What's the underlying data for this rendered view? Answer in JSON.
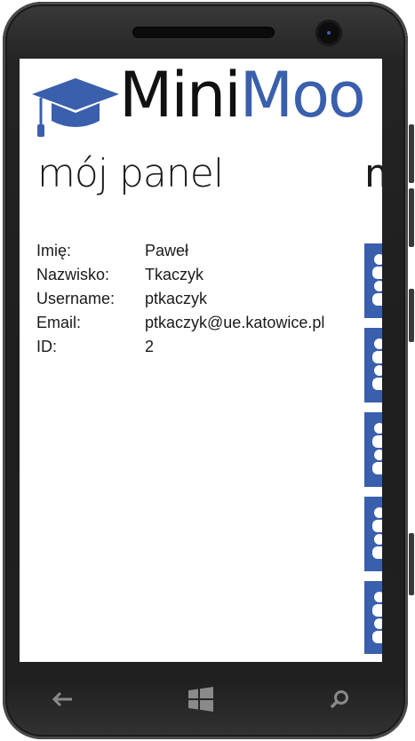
{
  "app": {
    "title_part1": "Mini",
    "title_part2": "Moo"
  },
  "page": {
    "section_title": "mój panel",
    "next_section_title": "m"
  },
  "profile": {
    "fields": [
      {
        "label": "Imię:",
        "value": "Paweł"
      },
      {
        "label": "Nazwisko:",
        "value": "Tkaczyk"
      },
      {
        "label": "Username:",
        "value": "ptkaczyk"
      },
      {
        "label": "Email:",
        "value": "ptkaczyk@ue.katowice.pl"
      },
      {
        "label": "ID:",
        "value": "2"
      }
    ]
  },
  "tiles": [
    {
      "icon": "people-icon"
    },
    {
      "icon": "people-icon"
    },
    {
      "icon": "people-icon"
    },
    {
      "icon": "people-icon"
    },
    {
      "icon": "people-icon"
    }
  ],
  "navbar": {
    "buttons": [
      {
        "icon": "back-arrow-icon"
      },
      {
        "icon": "windows-start-icon"
      },
      {
        "icon": "search-icon"
      }
    ]
  },
  "colors": {
    "accent": "#3a5fad",
    "bezel": "#1e1e1e",
    "screen_bg": "#ffffff",
    "text": "#1a1a1a"
  }
}
